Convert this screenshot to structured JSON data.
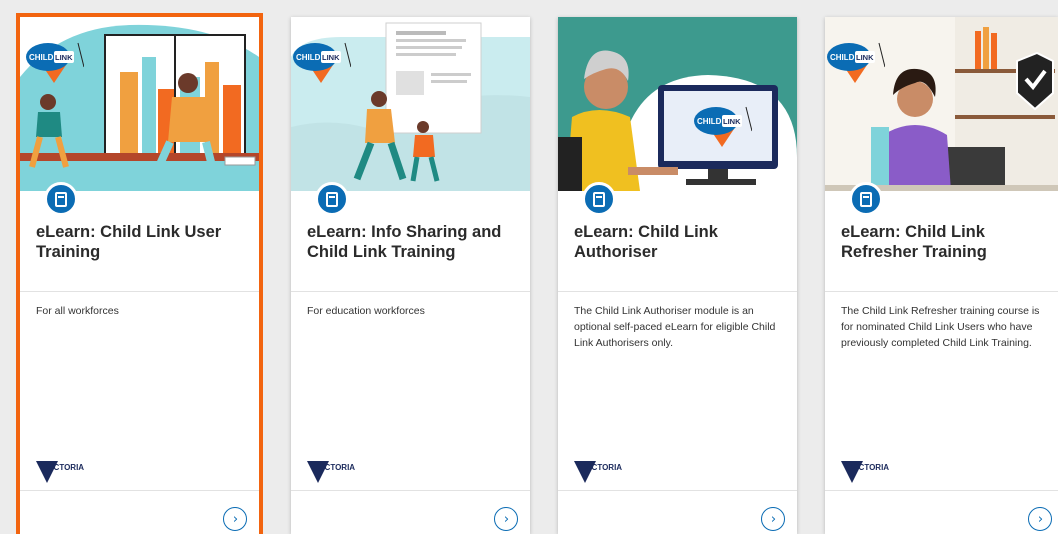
{
  "cards": [
    {
      "title": "eLearn: Child Link User Training",
      "description": "For all workforces",
      "badge_icon": "book-icon",
      "logo_text": "VICTORIA",
      "image_logo": "CHILD LINK",
      "selected": true
    },
    {
      "title": "eLearn: Info Sharing and Child Link Training",
      "description": "For education workforces",
      "badge_icon": "book-icon",
      "logo_text": "VICTORIA",
      "image_logo": "CHILD LINK",
      "selected": false
    },
    {
      "title": "eLearn: Child Link Authoriser",
      "description": "The Child Link Authoriser module is an optional self-paced eLearn for eligible Child Link Authorisers only.",
      "badge_icon": "book-icon",
      "logo_text": "VICTORIA",
      "image_logo": "CHILD LINK",
      "selected": false
    },
    {
      "title": "eLearn: Child Link Refresher Training",
      "description": "The Child Link Refresher training course is for nominated Child Link Users who have previously completed Child Link Training.",
      "badge_icon": "book-icon",
      "logo_text": "VICTORIA",
      "image_logo": "CHILD LINK",
      "selected": false
    }
  ],
  "colors": {
    "accent_blue": "#0b6cb4",
    "selection_orange": "#f2640f",
    "childlink_orange": "#f26a21",
    "victoria_navy": "#1b2a5c"
  }
}
